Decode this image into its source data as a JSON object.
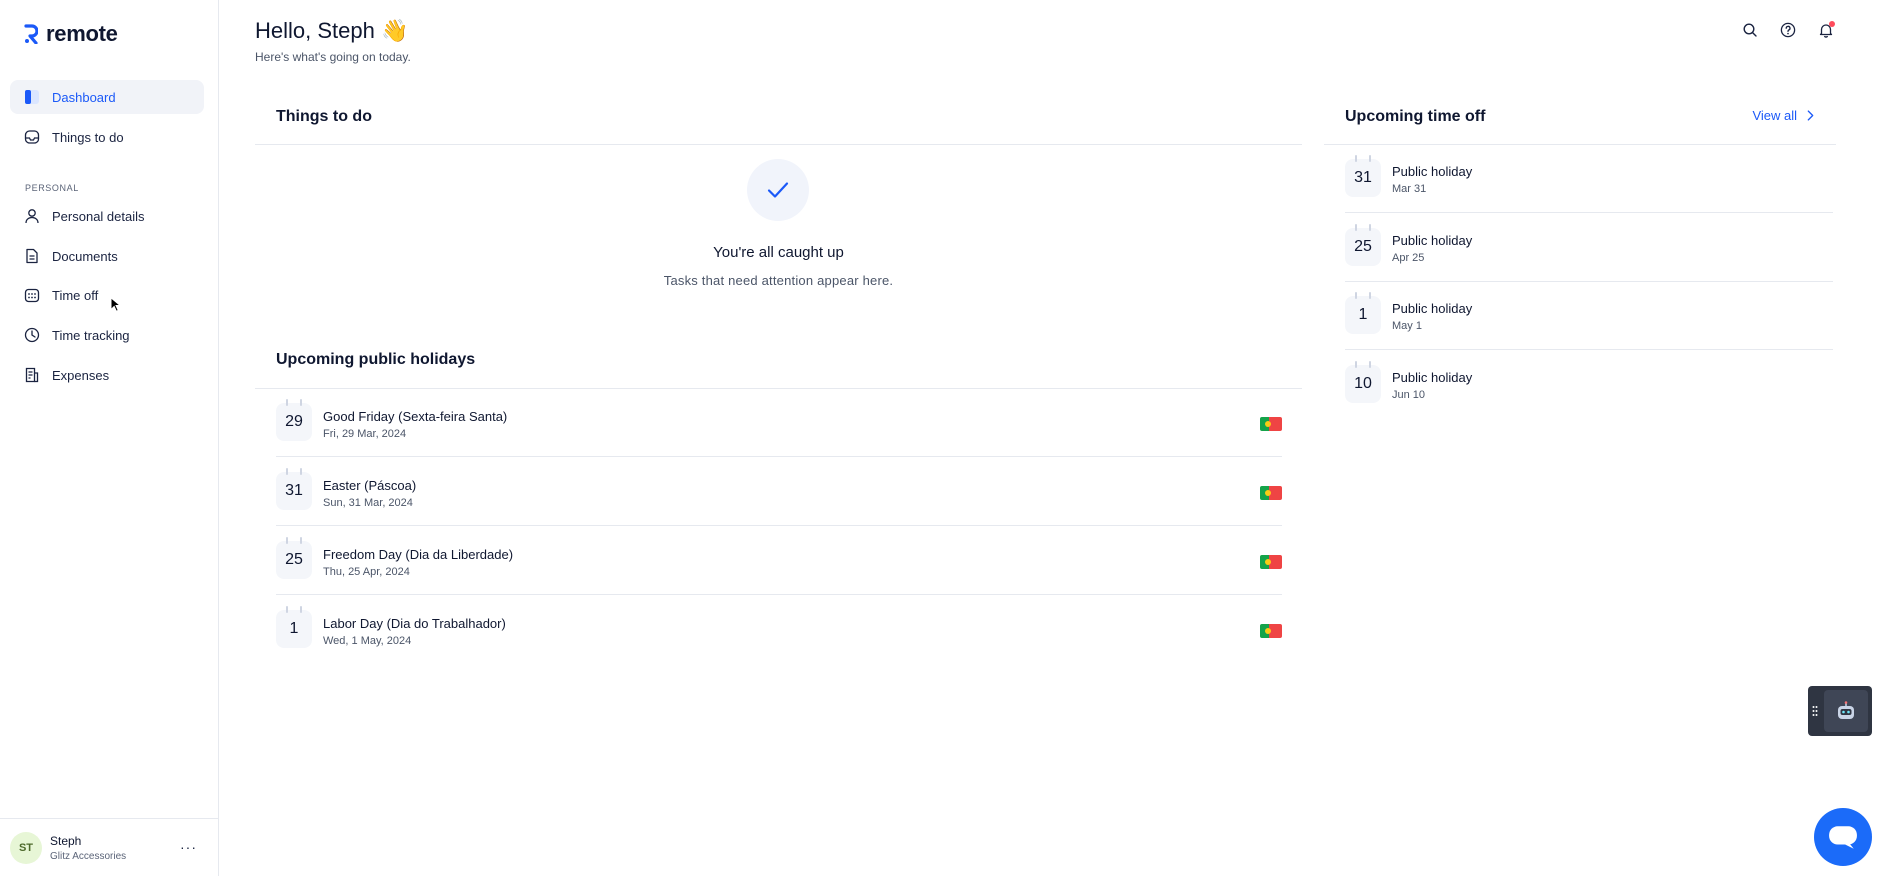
{
  "brand": {
    "name": "remote",
    "accent": "#1b59f8"
  },
  "sidebar": {
    "items": [
      {
        "label": "Dashboard",
        "icon": "dashboard-icon",
        "active": true
      },
      {
        "label": "Things to do",
        "icon": "inbox-icon"
      }
    ],
    "section_label": "PERSONAL",
    "personal_items": [
      {
        "label": "Personal details",
        "icon": "user-icon"
      },
      {
        "label": "Documents",
        "icon": "document-icon"
      },
      {
        "label": "Time off",
        "icon": "calendar-icon"
      },
      {
        "label": "Time tracking",
        "icon": "clock-icon"
      },
      {
        "label": "Expenses",
        "icon": "receipt-icon"
      }
    ],
    "user": {
      "initials": "ST",
      "name": "Steph",
      "company": "Glitz Accessories",
      "more": "···"
    }
  },
  "header": {
    "greeting": "Hello, Steph 👋",
    "subtitle": "Here's what's going on today.",
    "icons": [
      "search-icon",
      "help-icon",
      "bell-icon"
    ]
  },
  "things_to_do": {
    "title": "Things to do",
    "empty_title": "You're all caught up",
    "empty_subtitle": "Tasks that need attention appear here."
  },
  "public_holidays": {
    "title": "Upcoming public holidays",
    "items": [
      {
        "day": "29",
        "name": "Good Friday (Sexta-feira Santa)",
        "date": "Fri, 29 Mar, 2024"
      },
      {
        "day": "31",
        "name": "Easter (Páscoa)",
        "date": "Sun, 31 Mar, 2024"
      },
      {
        "day": "25",
        "name": "Freedom Day (Dia da Liberdade)",
        "date": "Thu, 25 Apr, 2024"
      },
      {
        "day": "1",
        "name": "Labor Day (Dia do Trabalhador)",
        "date": "Wed, 1 May, 2024"
      }
    ]
  },
  "time_off": {
    "title": "Upcoming time off",
    "view_all": "View all",
    "items": [
      {
        "day": "31",
        "name": "Public holiday",
        "date": "Mar 31"
      },
      {
        "day": "25",
        "name": "Public holiday",
        "date": "Apr 25"
      },
      {
        "day": "1",
        "name": "Public holiday",
        "date": "May 1"
      },
      {
        "day": "10",
        "name": "Public holiday",
        "date": "Jun 10"
      }
    ]
  }
}
